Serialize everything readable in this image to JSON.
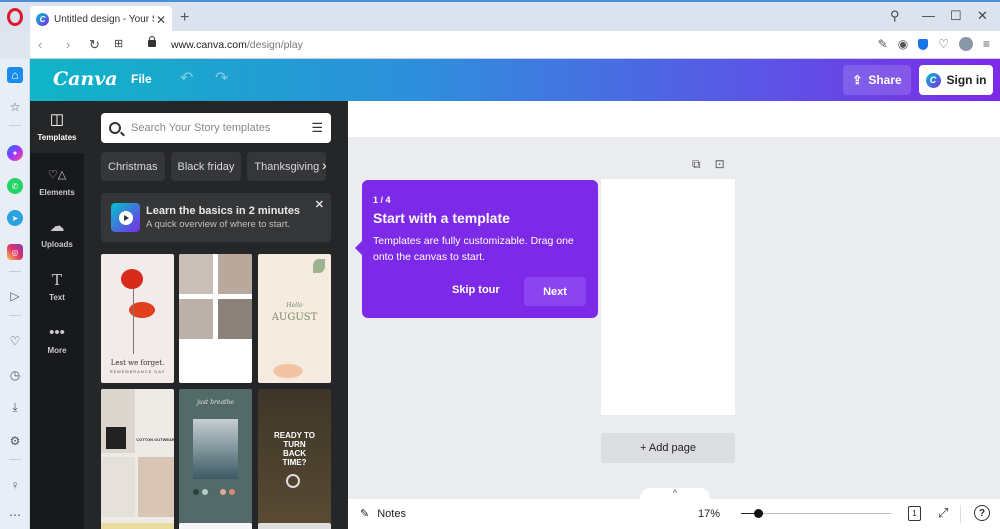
{
  "browser": {
    "tab_title": "Untitled design - Your Story",
    "url_host": "www.canva.com",
    "url_path": "/design/play",
    "icons": [
      "search-icon",
      "minimize-icon",
      "maximize-icon",
      "close-icon",
      "snapshot-edit-icon",
      "camera-icon",
      "shield-icon",
      "heart-icon",
      "profile-icon",
      "easy-setup-icon"
    ]
  },
  "opera_sidebar": {
    "items": [
      "home",
      "star",
      "messenger",
      "whatsapp",
      "telegram",
      "instagram",
      "player",
      "heart",
      "history",
      "downloads",
      "settings",
      "lightbulb",
      "more"
    ]
  },
  "header": {
    "logo": "Canva",
    "file_label": "File",
    "share_label": "Share",
    "signin_label": "Sign in",
    "accent_gradient_start": "#0fb5c6",
    "accent_gradient_end": "#7d2ae8"
  },
  "left_nav": {
    "items": [
      {
        "label": "Templates",
        "icon": "templates-icon",
        "active": true
      },
      {
        "label": "Elements",
        "icon": "elements-icon",
        "active": false
      },
      {
        "label": "Uploads",
        "icon": "upload-cloud-icon",
        "active": false
      },
      {
        "label": "Text",
        "icon": "text-icon",
        "active": false
      },
      {
        "label": "More",
        "icon": "more-icon",
        "active": false
      }
    ]
  },
  "panel": {
    "search_placeholder": "Search Your Story templates",
    "chips": [
      "Christmas",
      "Black friday",
      "Thanksgiving"
    ],
    "learn": {
      "title": "Learn the basics in 2 minutes",
      "subtitle": "A quick overview of where to start."
    },
    "templates": [
      {
        "name": "lest-we-forget",
        "text": "Lest we forget.",
        "subtext": "REMEMBRANCE DAY"
      },
      {
        "name": "photo-collage",
        "text": "",
        "subtext": ""
      },
      {
        "name": "hello-august",
        "text": "AUGUST",
        "subtext": "Hello"
      },
      {
        "name": "cotton-outwear",
        "text": "COTTON OUTWEAR",
        "subtext": ""
      },
      {
        "name": "just-breathe",
        "text": "just breathe",
        "subtext": ""
      },
      {
        "name": "ready-to-turn-back-time",
        "text": "READY TO TURN BACK TIME?",
        "subtext": ""
      }
    ]
  },
  "tour": {
    "step": "1 / 4",
    "title": "Start with a template",
    "body": "Templates are fully customizable. Drag one onto the canvas to start.",
    "skip_label": "Skip tour",
    "next_label": "Next",
    "color": "#7d2ae8"
  },
  "canvas": {
    "add_page_label": "+ Add page"
  },
  "bottom_bar": {
    "notes_label": "Notes",
    "zoom_percent": "17%",
    "zoom_value": 17,
    "page_number": "1",
    "help_label": "?"
  }
}
